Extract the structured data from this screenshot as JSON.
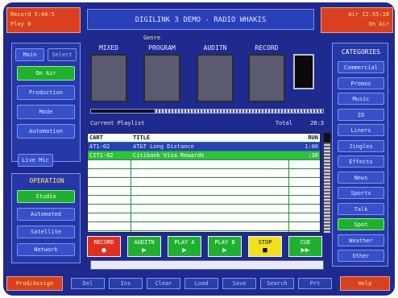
{
  "header": {
    "left_line1": "Record  5:44:5",
    "left_line2": "Play         0",
    "title": "DIGILINK 3 DEMO - RADIO WHAKIS",
    "right_line1": "Air  12:55:18",
    "right_line2": "On Air"
  },
  "left_panel": {
    "tabs": [
      "Main",
      "Select"
    ],
    "items": [
      "On Air",
      "Production",
      "Mode",
      "Automation"
    ],
    "live_mic": "Live Mic"
  },
  "operation": {
    "title": "OPERATION",
    "items": [
      "Studio",
      "Automated",
      "Satellite",
      "Network"
    ]
  },
  "main": {
    "genre_label": "Genre",
    "channels": [
      "MIXED",
      "PROGRAM",
      "AUDITN",
      "RECORD"
    ],
    "progress": 0.27,
    "playlist_label": "Current Playlist",
    "total_label": "Total",
    "total_value": "20:3",
    "table_headers": {
      "cart": "CART",
      "title": "TITLE",
      "run": "RUN"
    },
    "rows": [
      {
        "cart": "AT1-02",
        "title": "AT&T Long Distance",
        "run": "1:00",
        "style": "alt"
      },
      {
        "cart": "CIT1-02",
        "title": "Citibank Visa Rewards",
        "run": ":30",
        "style": "sel"
      }
    ],
    "empty_rows": 8
  },
  "transport": [
    {
      "label": "RECORD",
      "sym": "●",
      "color": "#e03020"
    },
    {
      "label": "AUDITN",
      "sym": "▶",
      "color": "#20b030"
    },
    {
      "label": "PLAY A",
      "sym": "▶",
      "color": "#20b030"
    },
    {
      "label": "PLAY B",
      "sym": "▶",
      "color": "#20b030"
    },
    {
      "label": "STOP",
      "sym": "■",
      "color": "#f0e020"
    },
    {
      "label": "CUE",
      "sym": "▶▶",
      "color": "#20b030"
    }
  ],
  "categories": {
    "title": "CATEGORIES",
    "items": [
      "Commercial",
      "Promos",
      "Music",
      "ID",
      "Liners",
      "Jingles",
      "Effects",
      "News",
      "Sports",
      "Talk",
      "Spot",
      "Weather",
      "Other"
    ],
    "selected_index": 10
  },
  "footer": {
    "left": "Prod/Assign",
    "buttons": [
      "Del",
      "Ins",
      "Clear",
      "Load",
      "Save",
      "Search",
      "Prt"
    ],
    "right": "Help"
  },
  "colors": {
    "background": "#1e2a8e",
    "accent_red": "#d84020",
    "accent_green": "#20b030",
    "accent_yellow": "#ffe680"
  }
}
